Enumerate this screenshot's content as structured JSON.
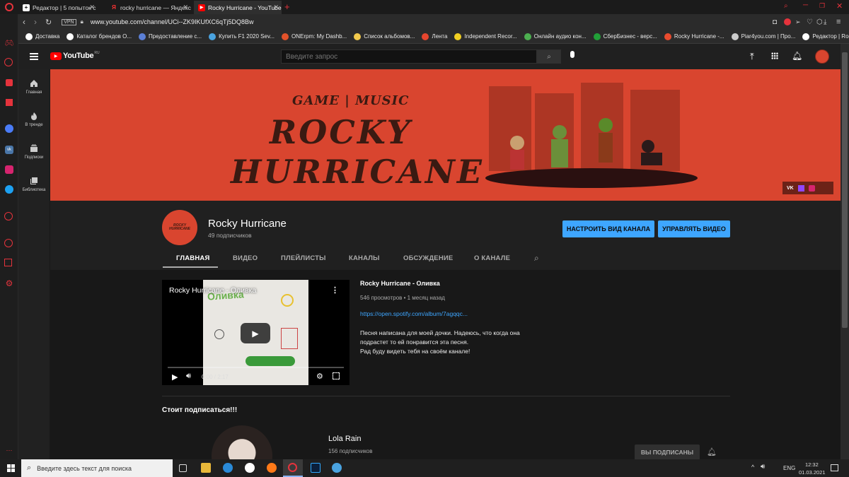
{
  "browser": {
    "tabs": [
      {
        "title": "Редактор | 5 попыток с YC",
        "active": false
      },
      {
        "title": "rocky hurricane — Яндекс",
        "active": false
      },
      {
        "title": "Rocky Hurricane - YouTube",
        "active": true
      }
    ],
    "vpn_label": "VPN",
    "url": "www.youtube.com/channel/UCi--ZK9IKUfXC6qTj5DQ8Bw",
    "bookmarks": [
      {
        "label": "Доставка",
        "color": "#ffffff"
      },
      {
        "label": "Каталог брендов О...",
        "color": "#ffffff"
      },
      {
        "label": "Предоставление с...",
        "color": "#5b7fd6"
      },
      {
        "label": "Купить F1 2020 Sev...",
        "color": "#4aa3e0"
      },
      {
        "label": "ONErpm: My Dashb...",
        "color": "#e2522a"
      },
      {
        "label": "Список альбомов...",
        "color": "#f2c94c"
      },
      {
        "label": "Лента",
        "color": "#e6452e"
      },
      {
        "label": "Independent Recor...",
        "color": "#f2d022"
      },
      {
        "label": "Онлайн аудио кон...",
        "color": "#4caf50"
      },
      {
        "label": "СберБизнес - верс...",
        "color": "#21a038"
      },
      {
        "label": "Rocky Hurricane -...",
        "color": "#e94b2e"
      },
      {
        "label": "Piar4you.com | Про...",
        "color": "#cccccc"
      },
      {
        "label": "Редактор | Rocky H...",
        "color": "#ffffff"
      }
    ]
  },
  "youtube": {
    "logo_text": "YouTube",
    "logo_region": "RU",
    "search_placeholder": "Введите запрос",
    "guide": [
      {
        "label": "Главная",
        "icon": "home-icon"
      },
      {
        "label": "В тренде",
        "icon": "fire-icon"
      },
      {
        "label": "Подписки",
        "icon": "subscriptions-icon"
      },
      {
        "label": "Библиотека",
        "icon": "library-icon"
      }
    ],
    "banner": {
      "tagline": "GAME | MUSIC",
      "line1": "ROCKY",
      "line2": "HURRICANE",
      "social": [
        "VK",
        "twitch",
        "instagram"
      ]
    },
    "channel": {
      "name": "Rocky Hurricane",
      "subscribers": "49 подписчиков",
      "customize_button": "НАСТРОИТЬ ВИД КАНАЛА",
      "manage_button": "УПРАВЛЯТЬ ВИДЕО",
      "tabs": [
        "ГЛАВНАЯ",
        "ВИДЕО",
        "ПЛЕЙЛИСТЫ",
        "КАНАЛЫ",
        "ОБСУЖДЕНИЕ",
        "О КАНАЛЕ"
      ],
      "active_tab": "ГЛАВНАЯ"
    },
    "featured": {
      "player_title": "Rocky Hurricane - Оливка",
      "thumb_text": "Оливка",
      "time": "0:00 / 2:17",
      "title": "Rocky Hurricane - Оливка",
      "meta": "546 просмотров • 1 месяц назад",
      "link": "https://open.spotify.com/album/7agqqc...",
      "description": [
        "Песня написана для моей дочки. Надеюсь, что когда она",
        "подрастет то ей понравится эта песня.",
        "Рад буду видеть тебя на своём канале!"
      ]
    },
    "section_title": "Стоит подписаться!!!",
    "recommended": {
      "name": "Lola Rain",
      "subscribers": "156 подписчиков",
      "subscribed_button": "ВЫ ПОДПИСАНЫ"
    }
  },
  "taskbar": {
    "search_placeholder": "Введите здесь текст для поиска",
    "language": "ENG",
    "time": "12:32",
    "date": "01.03.2021"
  }
}
